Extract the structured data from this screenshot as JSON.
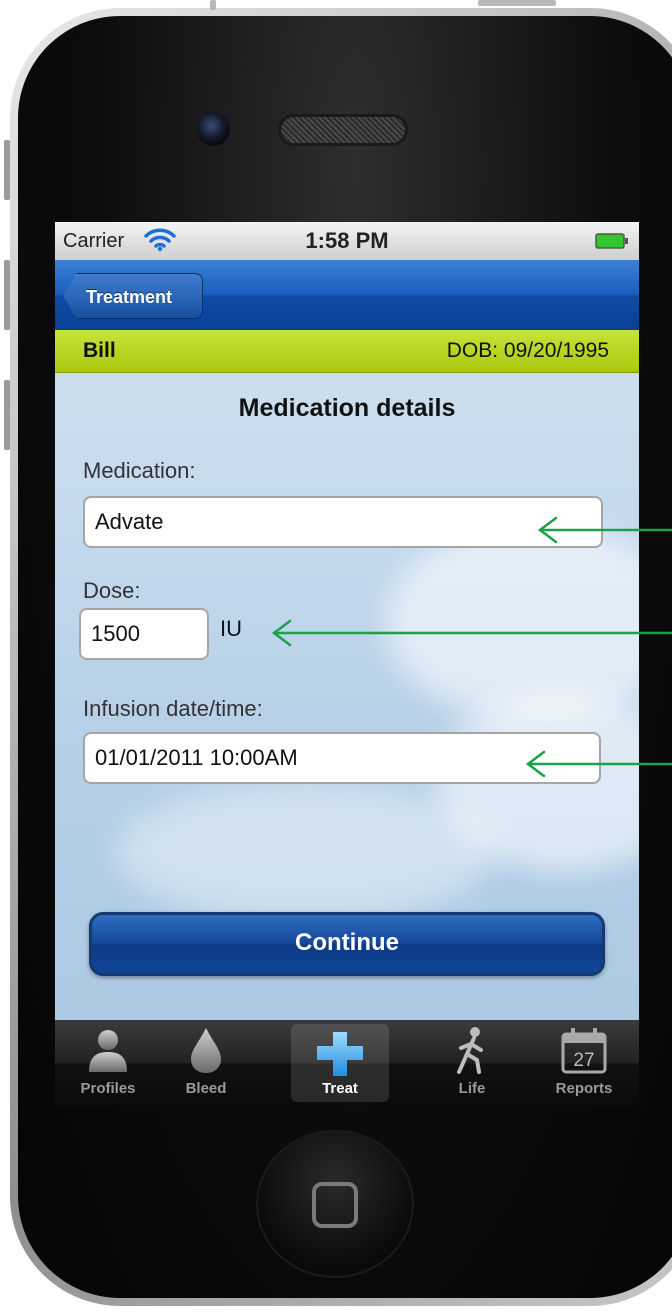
{
  "status_bar": {
    "carrier": "Carrier",
    "time": "1:58 PM"
  },
  "nav": {
    "back_label": "Treatment"
  },
  "patient": {
    "name": "Bill",
    "dob": "DOB: 09/20/1995"
  },
  "page": {
    "title": "Medication details"
  },
  "form": {
    "medication_label": "Medication:",
    "medication_value": "Advate",
    "dose_label": "Dose:",
    "dose_value": "1500",
    "dose_unit": "IU",
    "infusion_label": "Infusion date/time:",
    "infusion_value": "01/01/2011 10:00AM"
  },
  "actions": {
    "continue_label": "Continue"
  },
  "tabbar": {
    "tabs": [
      {
        "label": "Profiles",
        "icon": "person-icon"
      },
      {
        "label": "Bleed",
        "icon": "drop-icon"
      },
      {
        "label": "Treat",
        "icon": "plus-cross-icon",
        "selected": true
      },
      {
        "label": "Life",
        "icon": "walking-person-icon"
      },
      {
        "label": "Reports",
        "icon": "calendar-icon",
        "calendar_day": "27"
      }
    ]
  },
  "colors": {
    "nav_blue": "#1b5fbf",
    "patient_bar_green": "#b5d21f",
    "annotation_arrow": "#1aa14a",
    "treat_icon_blue": "#3aa6ea"
  }
}
